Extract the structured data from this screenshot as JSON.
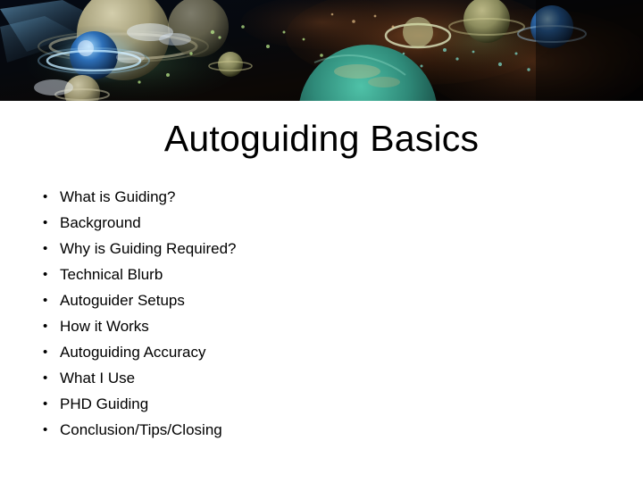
{
  "slide": {
    "title": "Autoguiding Basics",
    "bullet_marker": "•",
    "background_color": "#ffffff",
    "text_color": "#000000",
    "banner": {
      "name": "space-planets-banner",
      "description": "Dark space scene with ringed planets and nebula clouds",
      "colors": {
        "space_dark": "#05060a",
        "teal_planet": "#2f8a79",
        "blue_planet": "#2d6fb8",
        "khaki_planet": "#b9b184",
        "olive_planet": "#8f9060",
        "nebula_rust": "#5a3218",
        "glow_cyan": "#bfe8ff",
        "glow_white": "#eaf4ff"
      }
    },
    "bullets": [
      {
        "label": "What is Guiding?"
      },
      {
        "label": "Background"
      },
      {
        "label": "Why is Guiding Required?"
      },
      {
        "label": "Technical Blurb"
      },
      {
        "label": "Autoguider Setups"
      },
      {
        "label": "How it Works"
      },
      {
        "label": "Autoguiding Accuracy"
      },
      {
        "label": "What I Use"
      },
      {
        "label": "PHD Guiding"
      },
      {
        "label": "Conclusion/Tips/Closing"
      }
    ]
  }
}
